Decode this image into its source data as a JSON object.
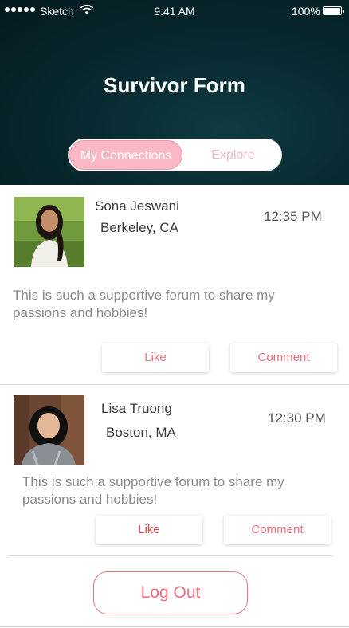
{
  "status_bar": {
    "carrier": "Sketch",
    "time": "9:41 AM",
    "battery": "100%"
  },
  "header": {
    "title": "Survivor Form"
  },
  "tabs": {
    "connections": "My Connections",
    "explore": "Explore",
    "active": "connections"
  },
  "posts": [
    {
      "name": "Sona Jeswani",
      "location": "Berkeley, CA",
      "time": "12:35 PM",
      "text_line1": "This is such a supportive forum to share my",
      "text_line2": "passions and hobbies!",
      "like_label": "Like",
      "comment_label": "Comment"
    },
    {
      "name": "Lisa Truong",
      "location": "Boston, MA",
      "time": "12:30 PM",
      "text_line1": "This is such a supportive forum to share my",
      "text_line2": "passions and hobbies!",
      "like_label": "Like",
      "comment_label": "Comment"
    }
  ],
  "logout_label": "Log Out",
  "colors": {
    "accent": "#f0707f",
    "tab_active": "#f9b8c4",
    "header_dark": "#062126"
  }
}
